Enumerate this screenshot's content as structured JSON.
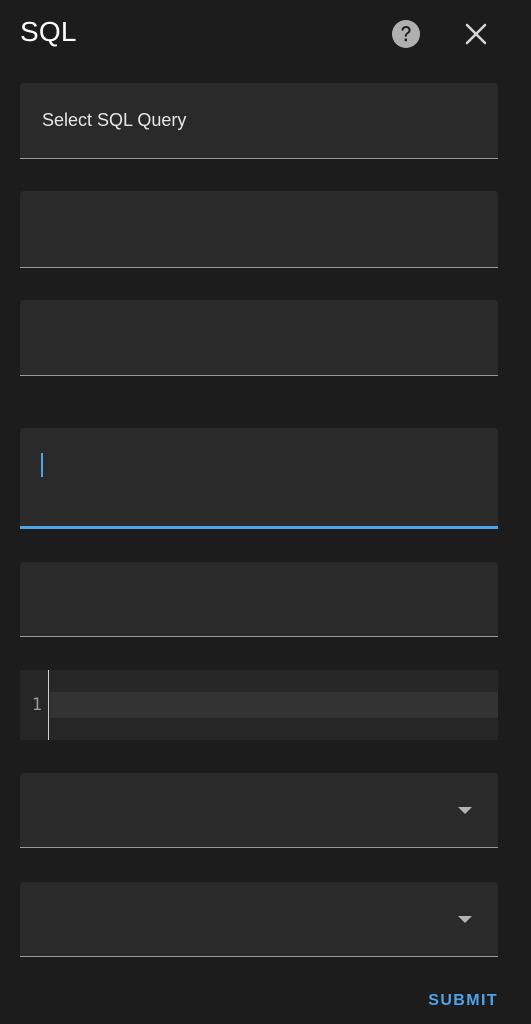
{
  "dialog": {
    "title": "SQL"
  },
  "fields": {
    "select_query_label": "Select SQL Query",
    "code_line_number": "1"
  },
  "actions": {
    "submit_label": "SUBMIT"
  },
  "icons": {
    "help": "help-circle-icon",
    "close": "close-icon",
    "dropdown": "chevron-down-icon"
  },
  "colors": {
    "accent": "#4fa3e8",
    "background": "#1c1c1c",
    "field": "#2a2a2a"
  }
}
